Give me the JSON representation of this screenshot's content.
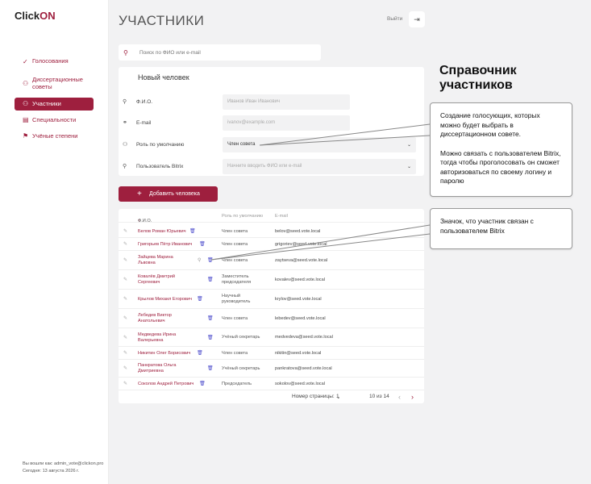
{
  "logo": {
    "text_main": "Click",
    "text_accent": "ON"
  },
  "sidebar": {
    "items": [
      {
        "label": "Голосования",
        "icon": "check-icon",
        "active": false
      },
      {
        "label": "Диссертационные советы",
        "icon": "people-icon",
        "active": false
      },
      {
        "label": "Участники",
        "icon": "participants-icon",
        "active": true
      },
      {
        "label": "Специальности",
        "icon": "document-icon",
        "active": false
      },
      {
        "label": "Учёные степени",
        "icon": "flag-icon",
        "active": false
      }
    ],
    "login_label": "Вы вошли как:",
    "login_value": "admin_vote@clickon.pro",
    "today_label": "Сегодня:",
    "today_value": "13 августа 2026 г."
  },
  "header": {
    "title": "УЧАСТНИКИ",
    "exit_label": "Выйти"
  },
  "search": {
    "placeholder": "Поиск по ФИО или e-mail"
  },
  "form": {
    "title": "Новый человек",
    "fields": [
      {
        "label": "Ф.И.О.",
        "placeholder": "Иванов Иван Иванович",
        "icon": "user-icon"
      },
      {
        "label": "E-mail",
        "placeholder": "ivanov@example.com",
        "icon": "link-icon"
      },
      {
        "label": "Роль по умолчанию",
        "value": "Член совета",
        "icon": "group-icon"
      },
      {
        "label": "Пользователь Bitrix",
        "placeholder": "Начните вводить ФИО или e-mail",
        "icon": "person-icon"
      }
    ],
    "add_button": "Добавить человека"
  },
  "table": {
    "headers": {
      "name": "Ф.И.О.",
      "role": "Роль по умолчанию",
      "email": "E-mail"
    },
    "rows": [
      {
        "name1": "Белов Роман Юрьевич",
        "name2": "",
        "role1": "Член совета",
        "role2": "",
        "email": "belov@seed.vote.local",
        "bitrix": false
      },
      {
        "name1": "Григорьев Пётр Иванович",
        "name2": "",
        "role1": "Член совета",
        "role2": "",
        "email": "grigoriev@seed.vote.local",
        "bitrix": false
      },
      {
        "name1": "Зайцева Марина",
        "name2": "Львовна",
        "role1": "Член совета",
        "role2": "",
        "email": "zaytseva@seed.vote.local",
        "bitrix": true
      },
      {
        "name1": "Ковалёв Дмитрий",
        "name2": "Сергеевич",
        "role1": "Заместитель",
        "role2": "председателя",
        "email": "kovalev@seed.vote.local",
        "bitrix": false
      },
      {
        "name1": "Крылов Михаил Егорович",
        "name2": "",
        "role1": "Научный",
        "role2": "руководитель",
        "email": "krylov@seed.vote.local",
        "bitrix": false
      },
      {
        "name1": "Лебедев Виктор",
        "name2": "Анатольевич",
        "role1": "Член совета",
        "role2": "",
        "email": "lebedev@seed.vote.local",
        "bitrix": false
      },
      {
        "name1": "Медведева Ирина",
        "name2": "Валерьевна",
        "role1": "Учёный секретарь",
        "role2": "",
        "email": "medvedeva@seed.vote.local",
        "bitrix": false
      },
      {
        "name1": "Никитин Олег Борисович",
        "name2": "",
        "role1": "Член совета",
        "role2": "",
        "email": "nikitin@seed.vote.local",
        "bitrix": false
      },
      {
        "name1": "Панкратова Ольга",
        "name2": "Дмитриевна",
        "role1": "Учёный секретарь",
        "role2": "",
        "email": "pankratova@seed.vote.local",
        "bitrix": false
      },
      {
        "name1": "Соколов Андрей Петрович",
        "name2": "",
        "role1": "Председатель",
        "role2": "",
        "email": "sokolov@seed.vote.local",
        "bitrix": false
      }
    ],
    "pager": {
      "page_label": "Номер страницы:",
      "page_value": "1",
      "range": "10 из 14",
      "prev": "‹",
      "next": "›"
    }
  },
  "annotations": {
    "title": "Справочник участников",
    "callout1": "Создание голосующих, которых можно будет выбрать в диссертационном совете.",
    "callout1b": "Можно связать с пользователем Bitrix, тогда чтобы проголосовать он сможет авторизоваться по своему логину и паролю",
    "callout2": "Значок, что участник связан с пользователем Bitrix"
  }
}
